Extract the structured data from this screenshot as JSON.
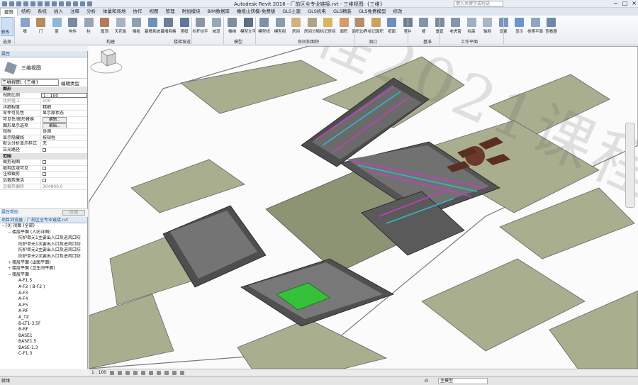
{
  "window": {
    "title": "Autodesk Revit 2016 -    厂前区全专业链接.rvt - 三维视图: {三维}",
    "search_placeholder": "键入关键字或短语",
    "controls": [
      "−",
      "□",
      "×"
    ]
  },
  "ribbon": {
    "tabs": [
      "建筑",
      "结构",
      "系统",
      "插入",
      "注释",
      "分析",
      "体量和场地",
      "协作",
      "视图",
      "管理",
      "附加模块",
      "BIM数据库",
      "橄榄山快模-免费版",
      "GLS土建",
      "GLS机电",
      "GLS精装",
      "GLS免费模型",
      "修改"
    ],
    "active_tab": 0,
    "modify_label": "修改",
    "tools": [
      {
        "label": "墙",
        "color": "#8aa3c8"
      },
      {
        "label": "门",
        "color": "#b58b5d"
      },
      {
        "label": "窗",
        "color": "#8fb6d8"
      },
      {
        "label": "构件",
        "color": "#7a8ba0"
      },
      {
        "label": "柱",
        "color": "#9aa5b3"
      },
      {
        "label": "屋顶",
        "color": "#b57a5d"
      },
      {
        "label": "天花板",
        "color": "#a5b3c2"
      },
      {
        "label": "楼板",
        "color": "#8fa0b4"
      },
      {
        "label": "幕墙系统",
        "color": "#6f8fb8"
      },
      {
        "label": "幕墙网格",
        "color": "#6c7f97"
      },
      {
        "label": "竖梃",
        "color": "#5f7895"
      },
      {
        "label": "栏杆扶手",
        "color": "#8d97a3"
      },
      {
        "label": "坡道",
        "color": "#97a8ba"
      },
      {
        "label": "楼梯",
        "color": "#7e8e9e"
      },
      {
        "label": "模型文字",
        "color": "#5e6f86"
      },
      {
        "label": "模型线",
        "color": "#7e91a9"
      },
      {
        "label": "模型组",
        "color": "#8c9cb0"
      },
      {
        "label": "房间",
        "color": "#cfb27c"
      },
      {
        "label": "房间分隔",
        "color": "#b0a289"
      },
      {
        "label": "标记房间",
        "color": "#d6b75f"
      },
      {
        "label": "面积",
        "color": "#d49a6a"
      },
      {
        "label": "面积边界",
        "color": "#b68e6b"
      },
      {
        "label": "标记面积",
        "color": "#caa15d"
      },
      {
        "label": "按面",
        "color": "#6e8fbd"
      },
      {
        "label": "竖井",
        "color": "#708090"
      },
      {
        "label": "墙",
        "color": "#8395ab"
      },
      {
        "label": "垂直",
        "color": "#7b8ca0"
      },
      {
        "label": "老虎窗",
        "color": "#8297ad"
      },
      {
        "label": "标高",
        "color": "#9db0c4"
      },
      {
        "label": "轴网",
        "color": "#a9b7c5"
      },
      {
        "label": "设置",
        "color": "#7a98be"
      },
      {
        "label": "显示",
        "color": "#6f94c9"
      },
      {
        "label": "参照平面",
        "color": "#8fa6c0"
      },
      {
        "label": "查看器",
        "color": "#6f8aa8"
      }
    ],
    "panels": [
      "选择",
      "构建",
      "楼梯坡道",
      "模型",
      "房间和面积",
      "洞口",
      "基准",
      "工作平面"
    ]
  },
  "properties": {
    "header": "属性",
    "type_name": "三维视图",
    "instance_select": "三维视图: {三维}",
    "edit_type": "编辑类型",
    "rows": [
      {
        "k": "图形",
        "v": "",
        "kind": "group"
      },
      {
        "k": "视图比例",
        "v": "1 : 100",
        "kind": "input"
      },
      {
        "k": "比例值 1:",
        "v": "100",
        "kind": "dim"
      },
      {
        "k": "详细程度",
        "v": "精细",
        "kind": ""
      },
      {
        "k": "零件可见性",
        "v": "显示原状态",
        "kind": ""
      },
      {
        "k": "可见性/图形替换",
        "v": "编辑...",
        "kind": "btn"
      },
      {
        "k": "图形显示选项",
        "v": "编辑...",
        "kind": "btn"
      },
      {
        "k": "规程",
        "v": "协调",
        "kind": ""
      },
      {
        "k": "显示隐藏线",
        "v": "按规程",
        "kind": ""
      },
      {
        "k": "默认分析显示样式",
        "v": "无",
        "kind": ""
      },
      {
        "k": "日光路径",
        "v": "",
        "kind": "chk"
      },
      {
        "k": "范围",
        "v": "",
        "kind": "group"
      },
      {
        "k": "裁剪视图",
        "v": "",
        "kind": "chk"
      },
      {
        "k": "裁剪区域可见",
        "v": "",
        "kind": "chk"
      },
      {
        "k": "注释裁剪",
        "v": "",
        "kind": "chk"
      },
      {
        "k": "远裁剪激活",
        "v": "",
        "kind": "chk"
      },
      {
        "k": "远裁剪偏移",
        "v": "304800.0",
        "kind": "dim"
      }
    ],
    "help": "属性帮助",
    "apply": "应用"
  },
  "browser": {
    "header": "项目浏览器 - 厂前区全专业链接.rvt",
    "nodes": [
      {
        "label": "[0] 视图 (全部)",
        "depth": 0,
        "toggle": "−"
      },
      {
        "label": "楼层平面 (人防详图)",
        "depth": 1,
        "toggle": "−"
      },
      {
        "label": "防护单元1主要出入口及进风口防",
        "depth": 2,
        "toggle": ""
      },
      {
        "label": "防护单元1次要出入口及进风口防",
        "depth": 2,
        "toggle": ""
      },
      {
        "label": "防护单元2主要出入口及进风口防",
        "depth": 2,
        "toggle": ""
      },
      {
        "label": "防护单元2次要出入口及进风口防",
        "depth": 2,
        "toggle": ""
      },
      {
        "label": "楼层平面 (出图平面)",
        "depth": 1,
        "toggle": "+"
      },
      {
        "label": "楼层平面 (卫生间平面)",
        "depth": 1,
        "toggle": "+"
      },
      {
        "label": "楼层平面",
        "depth": 1,
        "toggle": "−"
      },
      {
        "label": "A-F1.5",
        "depth": 2,
        "toggle": ""
      },
      {
        "label": "A-F2 ( B-F2 )",
        "depth": 2,
        "toggle": ""
      },
      {
        "label": "A-F3",
        "depth": 2,
        "toggle": ""
      },
      {
        "label": "A-F4",
        "depth": 2,
        "toggle": ""
      },
      {
        "label": "A-F5",
        "depth": 2,
        "toggle": ""
      },
      {
        "label": "A-RF",
        "depth": 2,
        "toggle": ""
      },
      {
        "label": "A_TZ",
        "depth": 2,
        "toggle": ""
      },
      {
        "label": "B-LT1-3.5F",
        "depth": 2,
        "toggle": ""
      },
      {
        "label": "B-RF",
        "depth": 2,
        "toggle": ""
      },
      {
        "label": "BASE1",
        "depth": 2,
        "toggle": ""
      },
      {
        "label": "BASE1.5",
        "depth": 2,
        "toggle": ""
      },
      {
        "label": "BASE-1.3",
        "depth": 2,
        "toggle": ""
      },
      {
        "label": "C-F1.3",
        "depth": 2,
        "toggle": ""
      }
    ]
  },
  "viewport": {
    "watermark": "优秀工程2021课程设计大赛",
    "scale": "1 : 100"
  },
  "status": {
    "text": "就绪",
    "zero": ":0",
    "model": "主模型"
  },
  "colors": {
    "lawn": "#a9ae8f",
    "road_edge": "#6c6c6c",
    "building": "#5b5b5b",
    "pipes_magenta": "#c43fbf",
    "pipes_cyan": "#36b6c7",
    "roof_green": "#35c23a"
  }
}
